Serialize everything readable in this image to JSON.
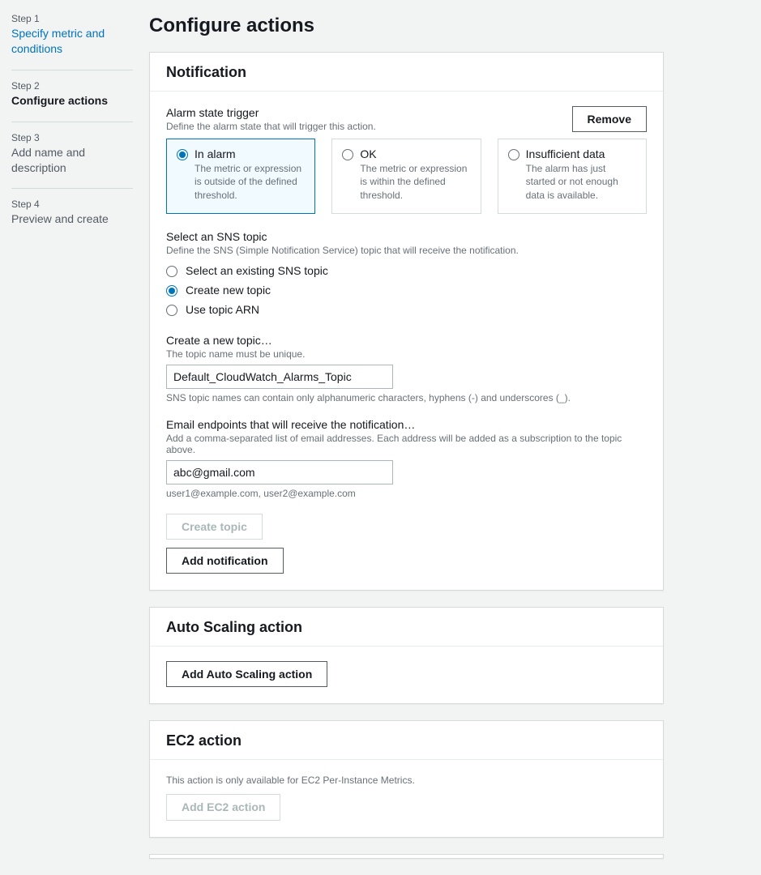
{
  "sidebar": {
    "steps": [
      {
        "num": "Step 1",
        "title": "Specify metric and conditions",
        "state": "link"
      },
      {
        "num": "Step 2",
        "title": "Configure actions",
        "state": "active"
      },
      {
        "num": "Step 3",
        "title": "Add name and description",
        "state": ""
      },
      {
        "num": "Step 4",
        "title": "Preview and create",
        "state": ""
      }
    ]
  },
  "page_title": "Configure actions",
  "notification": {
    "heading": "Notification",
    "trigger_label": "Alarm state trigger",
    "trigger_desc": "Define the alarm state that will trigger this action.",
    "remove_label": "Remove",
    "tiles": [
      {
        "title": "In alarm",
        "desc": "The metric or expression is outside of the defined threshold.",
        "selected": true
      },
      {
        "title": "OK",
        "desc": "The metric or expression is within the defined threshold.",
        "selected": false
      },
      {
        "title": "Insufficient data",
        "desc": "The alarm has just started or not enough data is available.",
        "selected": false
      }
    ],
    "sns_label": "Select an SNS topic",
    "sns_desc": "Define the SNS (Simple Notification Service) topic that will receive the notification.",
    "sns_options": [
      {
        "label": "Select an existing SNS topic",
        "checked": false
      },
      {
        "label": "Create new topic",
        "checked": true
      },
      {
        "label": "Use topic ARN",
        "checked": false
      }
    ],
    "create_topic_label": "Create a new topic…",
    "create_topic_desc": "The topic name must be unique.",
    "create_topic_value": "Default_CloudWatch_Alarms_Topic",
    "create_topic_help": "SNS topic names can contain only alphanumeric characters, hyphens (-) and underscores (_).",
    "email_label": "Email endpoints that will receive the notification…",
    "email_desc": "Add a comma-separated list of email addresses. Each address will be added as a subscription to the topic above.",
    "email_value": "abc@gmail.com",
    "email_help": "user1@example.com, user2@example.com",
    "create_topic_btn": "Create topic",
    "add_notification_btn": "Add notification"
  },
  "autoscaling": {
    "heading": "Auto Scaling action",
    "add_btn": "Add Auto Scaling action"
  },
  "ec2": {
    "heading": "EC2 action",
    "info": "This action is only available for EC2 Per-Instance Metrics.",
    "add_btn": "Add EC2 action"
  }
}
